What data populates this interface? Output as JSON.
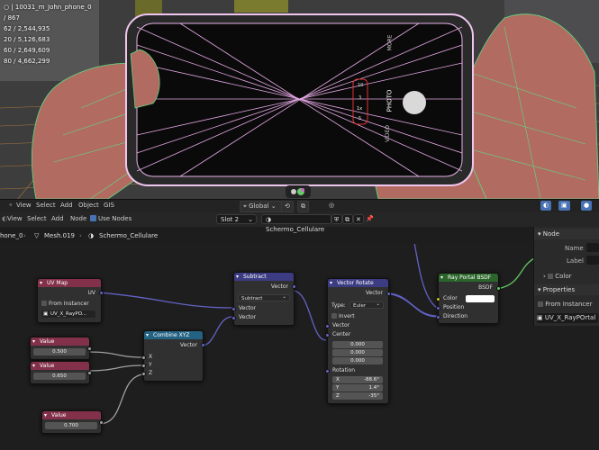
{
  "viewport": {
    "object_name": "10031_m_John_phone_0",
    "stats": [
      "/ 867",
      "62 / 2,544,935",
      "20 / 5,126,683",
      "60 / 2,649,609",
      "80 / 4,662,299"
    ],
    "phone_labels": {
      "mode_more": "MORE",
      "mode_photo": "PHOTO",
      "mode_video": "VIDEO",
      "zoom_1x": "1x",
      "zoom_2": "2",
      "zoom_3": "3",
      "zoom_5": "5",
      "zoom_10": "10"
    }
  },
  "viewport_toolbar": {
    "menus": [
      "View",
      "Select",
      "Add",
      "Object",
      "GIS"
    ],
    "transform_orientation": "Global"
  },
  "node_editor_header": {
    "menus": [
      "View",
      "Select",
      "Add",
      "Node"
    ],
    "use_nodes_label": "Use Nodes",
    "slot": "Slot 2",
    "material": "Schermo_Cellulare"
  },
  "breadcrumb": {
    "object": "hone_0",
    "mesh": "Mesh.019",
    "material": "Schermo_Cellulare"
  },
  "nodes": {
    "uv_map": {
      "title": "UV Map",
      "output": "UV",
      "from_instancer": "From Instancer",
      "map_name": "UV_X_RayPO..."
    },
    "value1": {
      "title": "Value",
      "value": "0.500"
    },
    "value2": {
      "title": "Value",
      "value": "0.650"
    },
    "value3": {
      "title": "Value",
      "value": "0.700"
    },
    "combine_xyz": {
      "title": "Combine XYZ",
      "output": "Vector",
      "inputs": [
        "X",
        "Y",
        "Z"
      ]
    },
    "subtract": {
      "title": "Subtract",
      "output": "Vector",
      "operation": "Subtract",
      "inputs": [
        "Vector",
        "Vector"
      ]
    },
    "vector_rotate": {
      "title": "Vector Rotate",
      "output": "Vector",
      "type_label": "Type:",
      "type_value": "Euler",
      "invert": "Invert",
      "inputs": [
        "Vector",
        "Center"
      ],
      "center": [
        "0.000",
        "0.000",
        "0.000"
      ],
      "rotation_label": "Rotation",
      "rotation": [
        {
          "axis": "X",
          "value": "-88.6°"
        },
        {
          "axis": "Y",
          "value": "1.4°"
        },
        {
          "axis": "Z",
          "value": "-35°"
        }
      ]
    },
    "ray_portal": {
      "title": "Ray Portal BSDF",
      "output": "BSDF",
      "inputs": [
        "Color",
        "Position",
        "Direction"
      ],
      "color_hex": "#ffffff"
    }
  },
  "sidebar": {
    "node_header": "Node",
    "name_label": "Name",
    "label_label": "Label",
    "color_label": "Color",
    "properties_header": "Properties",
    "from_instancer": "From Instancer",
    "uv_map_value": "UV_X_RayPOrtal"
  },
  "colors": {
    "input_header": "#83314a",
    "vector_header": "#3c3c83",
    "converter_header": "#246283",
    "shader_header": "#2b652b",
    "accent": "#4772b3"
  }
}
